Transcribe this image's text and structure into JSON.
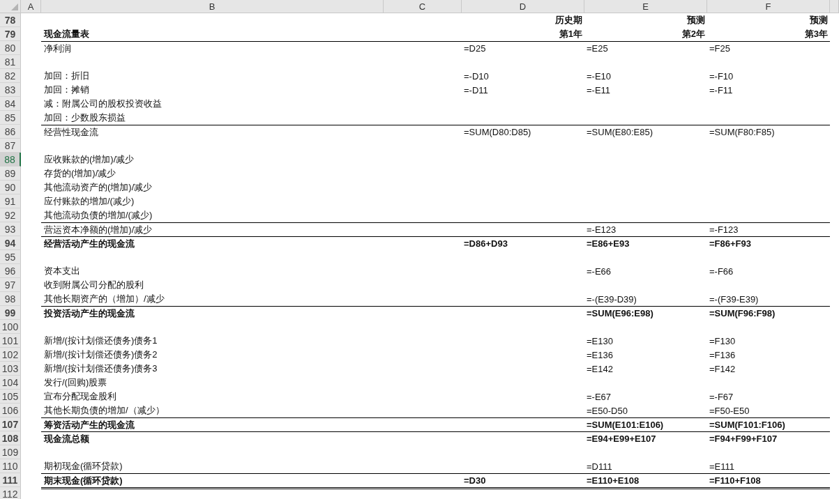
{
  "columns": [
    {
      "label": "A"
    },
    {
      "label": "B"
    },
    {
      "label": "C"
    },
    {
      "label": "D"
    },
    {
      "label": "E"
    },
    {
      "label": "F"
    }
  ],
  "rows": [
    {
      "number": "78",
      "selected": false,
      "kind": "header",
      "bold": true,
      "rule_above": false,
      "double_rule_above": false,
      "d": "历史期",
      "e": "预测",
      "f": "预测"
    },
    {
      "number": "79",
      "selected": false,
      "kind": "header",
      "bold": true,
      "rule_above": false,
      "double_rule_above": false,
      "label": "现金流量表",
      "d": "第1年",
      "e": "第2年",
      "f": "第3年"
    },
    {
      "number": "80",
      "selected": false,
      "kind": "item",
      "bold": false,
      "rule_above": true,
      "double_rule_above": false,
      "label": "净利润",
      "d": "=D25",
      "e": "=E25",
      "f": "=F25"
    },
    {
      "number": "81",
      "selected": false,
      "kind": "item",
      "bold": false,
      "rule_above": false,
      "double_rule_above": false
    },
    {
      "number": "82",
      "selected": false,
      "kind": "item",
      "bold": false,
      "rule_above": false,
      "double_rule_above": false,
      "label": "加回：折旧",
      "d": "=-D10",
      "e": "=-E10",
      "f": "=-F10"
    },
    {
      "number": "83",
      "selected": false,
      "kind": "item",
      "bold": false,
      "rule_above": false,
      "double_rule_above": false,
      "label": "加回：摊销",
      "d": "=-D11",
      "e": "=-E11",
      "f": "=-F11"
    },
    {
      "number": "84",
      "selected": false,
      "kind": "item",
      "bold": false,
      "rule_above": false,
      "double_rule_above": false,
      "label": "减：附属公司的股权投资收益"
    },
    {
      "number": "85",
      "selected": false,
      "kind": "item",
      "bold": false,
      "rule_above": false,
      "double_rule_above": false,
      "label": "加回：少数股东损益"
    },
    {
      "number": "86",
      "selected": false,
      "kind": "item",
      "bold": false,
      "rule_above": true,
      "double_rule_above": false,
      "label": "经营性现金流",
      "d": "=SUM(D80:D85)",
      "e": "=SUM(E80:E85)",
      "f": "=SUM(F80:F85)"
    },
    {
      "number": "87",
      "selected": false,
      "kind": "item",
      "bold": false,
      "rule_above": false,
      "double_rule_above": false
    },
    {
      "number": "88",
      "selected": true,
      "kind": "item",
      "bold": false,
      "rule_above": false,
      "double_rule_above": false,
      "label": "应收账款的(增加)/减少"
    },
    {
      "number": "89",
      "selected": false,
      "kind": "item",
      "bold": false,
      "rule_above": false,
      "double_rule_above": false,
      "label": "存货的(增加)/减少"
    },
    {
      "number": "90",
      "selected": false,
      "kind": "item",
      "bold": false,
      "rule_above": false,
      "double_rule_above": false,
      "label": "其他流动资产的(增加)/减少"
    },
    {
      "number": "91",
      "selected": false,
      "kind": "item",
      "bold": false,
      "rule_above": false,
      "double_rule_above": false,
      "label": "应付账款的增加/(减少)"
    },
    {
      "number": "92",
      "selected": false,
      "kind": "item",
      "bold": false,
      "rule_above": false,
      "double_rule_above": false,
      "label": "其他流动负债的增加/(减少)"
    },
    {
      "number": "93",
      "selected": false,
      "kind": "item",
      "bold": false,
      "rule_above": true,
      "double_rule_above": false,
      "label": "营运资本净额的(增加)/减少",
      "e": "=-E123",
      "f": "=-F123"
    },
    {
      "number": "94",
      "selected": false,
      "kind": "item",
      "bold": true,
      "rule_above": true,
      "double_rule_above": false,
      "label": "经营活动产生的现金流",
      "d": "=D86+D93",
      "e": "=E86+E93",
      "f": "=F86+F93"
    },
    {
      "number": "95",
      "selected": false,
      "kind": "item",
      "bold": false,
      "rule_above": false,
      "double_rule_above": false
    },
    {
      "number": "96",
      "selected": false,
      "kind": "item",
      "bold": false,
      "rule_above": false,
      "double_rule_above": false,
      "label": "资本支出",
      "e": "=-E66",
      "f": "=-F66"
    },
    {
      "number": "97",
      "selected": false,
      "kind": "item",
      "bold": false,
      "rule_above": false,
      "double_rule_above": false,
      "label": "收到附属公司分配的股利"
    },
    {
      "number": "98",
      "selected": false,
      "kind": "item",
      "bold": false,
      "rule_above": false,
      "double_rule_above": false,
      "label": "其他长期资产的（增加）/减少",
      "e": "=-(E39-D39)",
      "f": "=-(F39-E39)"
    },
    {
      "number": "99",
      "selected": false,
      "kind": "item",
      "bold": true,
      "rule_above": true,
      "double_rule_above": false,
      "label": "投资活动产生的现金流",
      "e": "=SUM(E96:E98)",
      "f": "=SUM(F96:F98)"
    },
    {
      "number": "100",
      "selected": false,
      "kind": "item",
      "bold": false,
      "rule_above": false,
      "double_rule_above": false
    },
    {
      "number": "101",
      "selected": false,
      "kind": "item",
      "bold": false,
      "rule_above": false,
      "double_rule_above": false,
      "label": "新增/(按计划偿还债务)债务1",
      "e": "=E130",
      "f": "=F130"
    },
    {
      "number": "102",
      "selected": false,
      "kind": "item",
      "bold": false,
      "rule_above": false,
      "double_rule_above": false,
      "label": "新增/(按计划偿还债务)债务2",
      "e": "=E136",
      "f": "=F136"
    },
    {
      "number": "103",
      "selected": false,
      "kind": "item",
      "bold": false,
      "rule_above": false,
      "double_rule_above": false,
      "label": "新增/(按计划偿还债务)债务3",
      "e": "=E142",
      "f": "=F142"
    },
    {
      "number": "104",
      "selected": false,
      "kind": "item",
      "bold": false,
      "rule_above": false,
      "double_rule_above": false,
      "label": "发行/(回购)股票"
    },
    {
      "number": "105",
      "selected": false,
      "kind": "item",
      "bold": false,
      "rule_above": false,
      "double_rule_above": false,
      "label": "宣布分配现金股利",
      "e": "=-E67",
      "f": "=-F67"
    },
    {
      "number": "106",
      "selected": false,
      "kind": "item",
      "bold": false,
      "rule_above": false,
      "double_rule_above": false,
      "label": "其他长期负债的增加/（减少）",
      "e": "=E50-D50",
      "f": "=F50-E50"
    },
    {
      "number": "107",
      "selected": false,
      "kind": "item",
      "bold": true,
      "rule_above": true,
      "double_rule_above": false,
      "label": "筹资活动产生的现金流",
      "e": "=SUM(E101:E106)",
      "f": "=SUM(F101:F106)"
    },
    {
      "number": "108",
      "selected": false,
      "kind": "item",
      "bold": true,
      "rule_above": true,
      "double_rule_above": false,
      "label": "现金流总额",
      "e": "=E94+E99+E107",
      "f": "=F94+F99+F107"
    },
    {
      "number": "109",
      "selected": false,
      "kind": "item",
      "bold": false,
      "rule_above": false,
      "double_rule_above": false
    },
    {
      "number": "110",
      "selected": false,
      "kind": "item",
      "bold": false,
      "rule_above": false,
      "double_rule_above": false,
      "label": "期初现金(循环贷款)",
      "e": "=D111",
      "f": "=E111"
    },
    {
      "number": "111",
      "selected": false,
      "kind": "item",
      "bold": true,
      "rule_above": true,
      "double_rule_above": false,
      "label": "期末现金(循环贷款)",
      "d": "=D30",
      "e": "=E110+E108",
      "f": "=F110+F108"
    },
    {
      "number": "112",
      "selected": false,
      "kind": "item",
      "bold": false,
      "rule_above": false,
      "double_rule_above": true
    }
  ]
}
